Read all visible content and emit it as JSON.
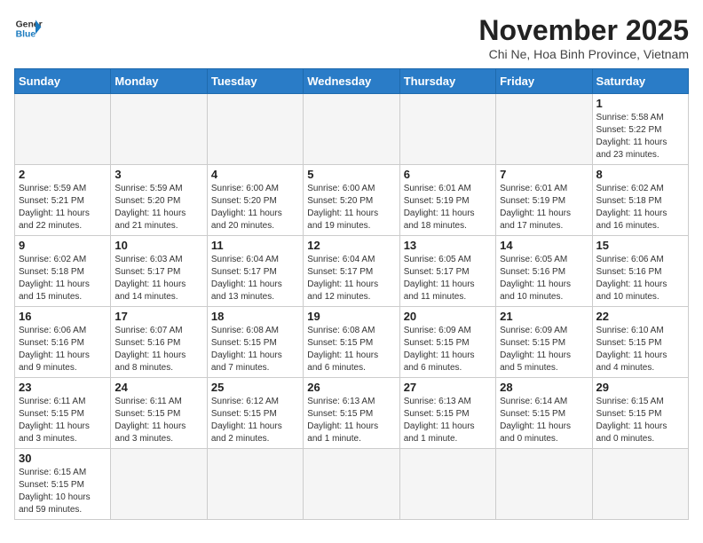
{
  "header": {
    "logo_general": "General",
    "logo_blue": "Blue",
    "month_title": "November 2025",
    "location": "Chi Ne, Hoa Binh Province, Vietnam"
  },
  "weekdays": [
    "Sunday",
    "Monday",
    "Tuesday",
    "Wednesday",
    "Thursday",
    "Friday",
    "Saturday"
  ],
  "days": [
    {
      "num": "",
      "info": ""
    },
    {
      "num": "",
      "info": ""
    },
    {
      "num": "",
      "info": ""
    },
    {
      "num": "",
      "info": ""
    },
    {
      "num": "",
      "info": ""
    },
    {
      "num": "",
      "info": ""
    },
    {
      "num": "1",
      "info": "Sunrise: 5:58 AM\nSunset: 5:22 PM\nDaylight: 11 hours\nand 23 minutes."
    },
    {
      "num": "2",
      "info": "Sunrise: 5:59 AM\nSunset: 5:21 PM\nDaylight: 11 hours\nand 22 minutes."
    },
    {
      "num": "3",
      "info": "Sunrise: 5:59 AM\nSunset: 5:20 PM\nDaylight: 11 hours\nand 21 minutes."
    },
    {
      "num": "4",
      "info": "Sunrise: 6:00 AM\nSunset: 5:20 PM\nDaylight: 11 hours\nand 20 minutes."
    },
    {
      "num": "5",
      "info": "Sunrise: 6:00 AM\nSunset: 5:20 PM\nDaylight: 11 hours\nand 19 minutes."
    },
    {
      "num": "6",
      "info": "Sunrise: 6:01 AM\nSunset: 5:19 PM\nDaylight: 11 hours\nand 18 minutes."
    },
    {
      "num": "7",
      "info": "Sunrise: 6:01 AM\nSunset: 5:19 PM\nDaylight: 11 hours\nand 17 minutes."
    },
    {
      "num": "8",
      "info": "Sunrise: 6:02 AM\nSunset: 5:18 PM\nDaylight: 11 hours\nand 16 minutes."
    },
    {
      "num": "9",
      "info": "Sunrise: 6:02 AM\nSunset: 5:18 PM\nDaylight: 11 hours\nand 15 minutes."
    },
    {
      "num": "10",
      "info": "Sunrise: 6:03 AM\nSunset: 5:17 PM\nDaylight: 11 hours\nand 14 minutes."
    },
    {
      "num": "11",
      "info": "Sunrise: 6:04 AM\nSunset: 5:17 PM\nDaylight: 11 hours\nand 13 minutes."
    },
    {
      "num": "12",
      "info": "Sunrise: 6:04 AM\nSunset: 5:17 PM\nDaylight: 11 hours\nand 12 minutes."
    },
    {
      "num": "13",
      "info": "Sunrise: 6:05 AM\nSunset: 5:17 PM\nDaylight: 11 hours\nand 11 minutes."
    },
    {
      "num": "14",
      "info": "Sunrise: 6:05 AM\nSunset: 5:16 PM\nDaylight: 11 hours\nand 10 minutes."
    },
    {
      "num": "15",
      "info": "Sunrise: 6:06 AM\nSunset: 5:16 PM\nDaylight: 11 hours\nand 10 minutes."
    },
    {
      "num": "16",
      "info": "Sunrise: 6:06 AM\nSunset: 5:16 PM\nDaylight: 11 hours\nand 9 minutes."
    },
    {
      "num": "17",
      "info": "Sunrise: 6:07 AM\nSunset: 5:16 PM\nDaylight: 11 hours\nand 8 minutes."
    },
    {
      "num": "18",
      "info": "Sunrise: 6:08 AM\nSunset: 5:15 PM\nDaylight: 11 hours\nand 7 minutes."
    },
    {
      "num": "19",
      "info": "Sunrise: 6:08 AM\nSunset: 5:15 PM\nDaylight: 11 hours\nand 6 minutes."
    },
    {
      "num": "20",
      "info": "Sunrise: 6:09 AM\nSunset: 5:15 PM\nDaylight: 11 hours\nand 6 minutes."
    },
    {
      "num": "21",
      "info": "Sunrise: 6:09 AM\nSunset: 5:15 PM\nDaylight: 11 hours\nand 5 minutes."
    },
    {
      "num": "22",
      "info": "Sunrise: 6:10 AM\nSunset: 5:15 PM\nDaylight: 11 hours\nand 4 minutes."
    },
    {
      "num": "23",
      "info": "Sunrise: 6:11 AM\nSunset: 5:15 PM\nDaylight: 11 hours\nand 3 minutes."
    },
    {
      "num": "24",
      "info": "Sunrise: 6:11 AM\nSunset: 5:15 PM\nDaylight: 11 hours\nand 3 minutes."
    },
    {
      "num": "25",
      "info": "Sunrise: 6:12 AM\nSunset: 5:15 PM\nDaylight: 11 hours\nand 2 minutes."
    },
    {
      "num": "26",
      "info": "Sunrise: 6:13 AM\nSunset: 5:15 PM\nDaylight: 11 hours\nand 1 minute."
    },
    {
      "num": "27",
      "info": "Sunrise: 6:13 AM\nSunset: 5:15 PM\nDaylight: 11 hours\nand 1 minute."
    },
    {
      "num": "28",
      "info": "Sunrise: 6:14 AM\nSunset: 5:15 PM\nDaylight: 11 hours\nand 0 minutes."
    },
    {
      "num": "29",
      "info": "Sunrise: 6:15 AM\nSunset: 5:15 PM\nDaylight: 11 hours\nand 0 minutes."
    },
    {
      "num": "30",
      "info": "Sunrise: 6:15 AM\nSunset: 5:15 PM\nDaylight: 10 hours\nand 59 minutes."
    }
  ]
}
